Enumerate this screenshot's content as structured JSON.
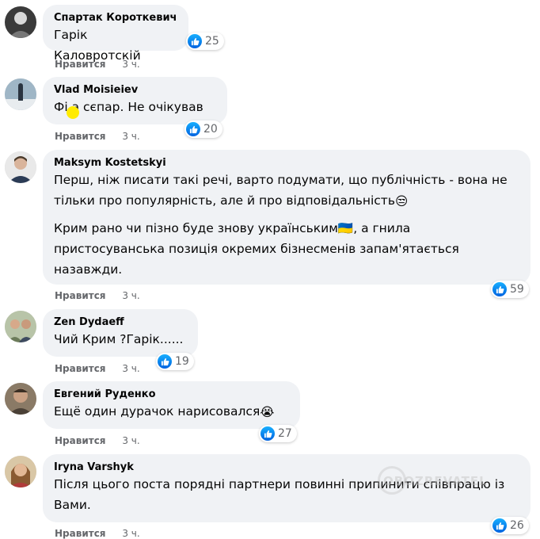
{
  "like_label": "Нравится",
  "colors": {
    "like_blue": "#1877f2",
    "bubble_bg": "#f0f2f5",
    "meta_gray": "#65676b"
  },
  "watermark": "OBOZREVATEL",
  "comments": [
    {
      "author": "Спартак Короткевич",
      "text": "Гарік Каловротскій",
      "likes": "25",
      "time": "3 ч."
    },
    {
      "author": "Vlad Moisieiev",
      "text": "Фі а сєпар. Не очікував",
      "likes": "20",
      "time": "3 ч."
    },
    {
      "author": "Maksym Kostetskyi",
      "text": "Перш, ніж писати такі речі, варто подумати, що публічність - вона не тільки про популярність, але й про відповідальність",
      "emoji1": "😒",
      "text2a": "Крим рано чи пізно буде знову українським",
      "emoji2": "🇺🇦",
      "text2b": ", а гнила пристосуванська позиція окремих бізнесменів запам'ятається назавжди.",
      "likes": "59",
      "time": "3 ч."
    },
    {
      "author": "Zen Dydaeff",
      "text": "Чий Крим ?Гарік......",
      "likes": "19",
      "time": "3 ч."
    },
    {
      "author": "Евгений Руденко",
      "text": "Ещё один дурачок нарисовался",
      "emoji": "😭",
      "likes": "27",
      "time": "3 ч."
    },
    {
      "author": "Iryna Varshyk",
      "text": "Після цього поста порядні партнери повинні припинити співпрацю із Вами.",
      "likes": "26",
      "time": "3 ч."
    }
  ]
}
